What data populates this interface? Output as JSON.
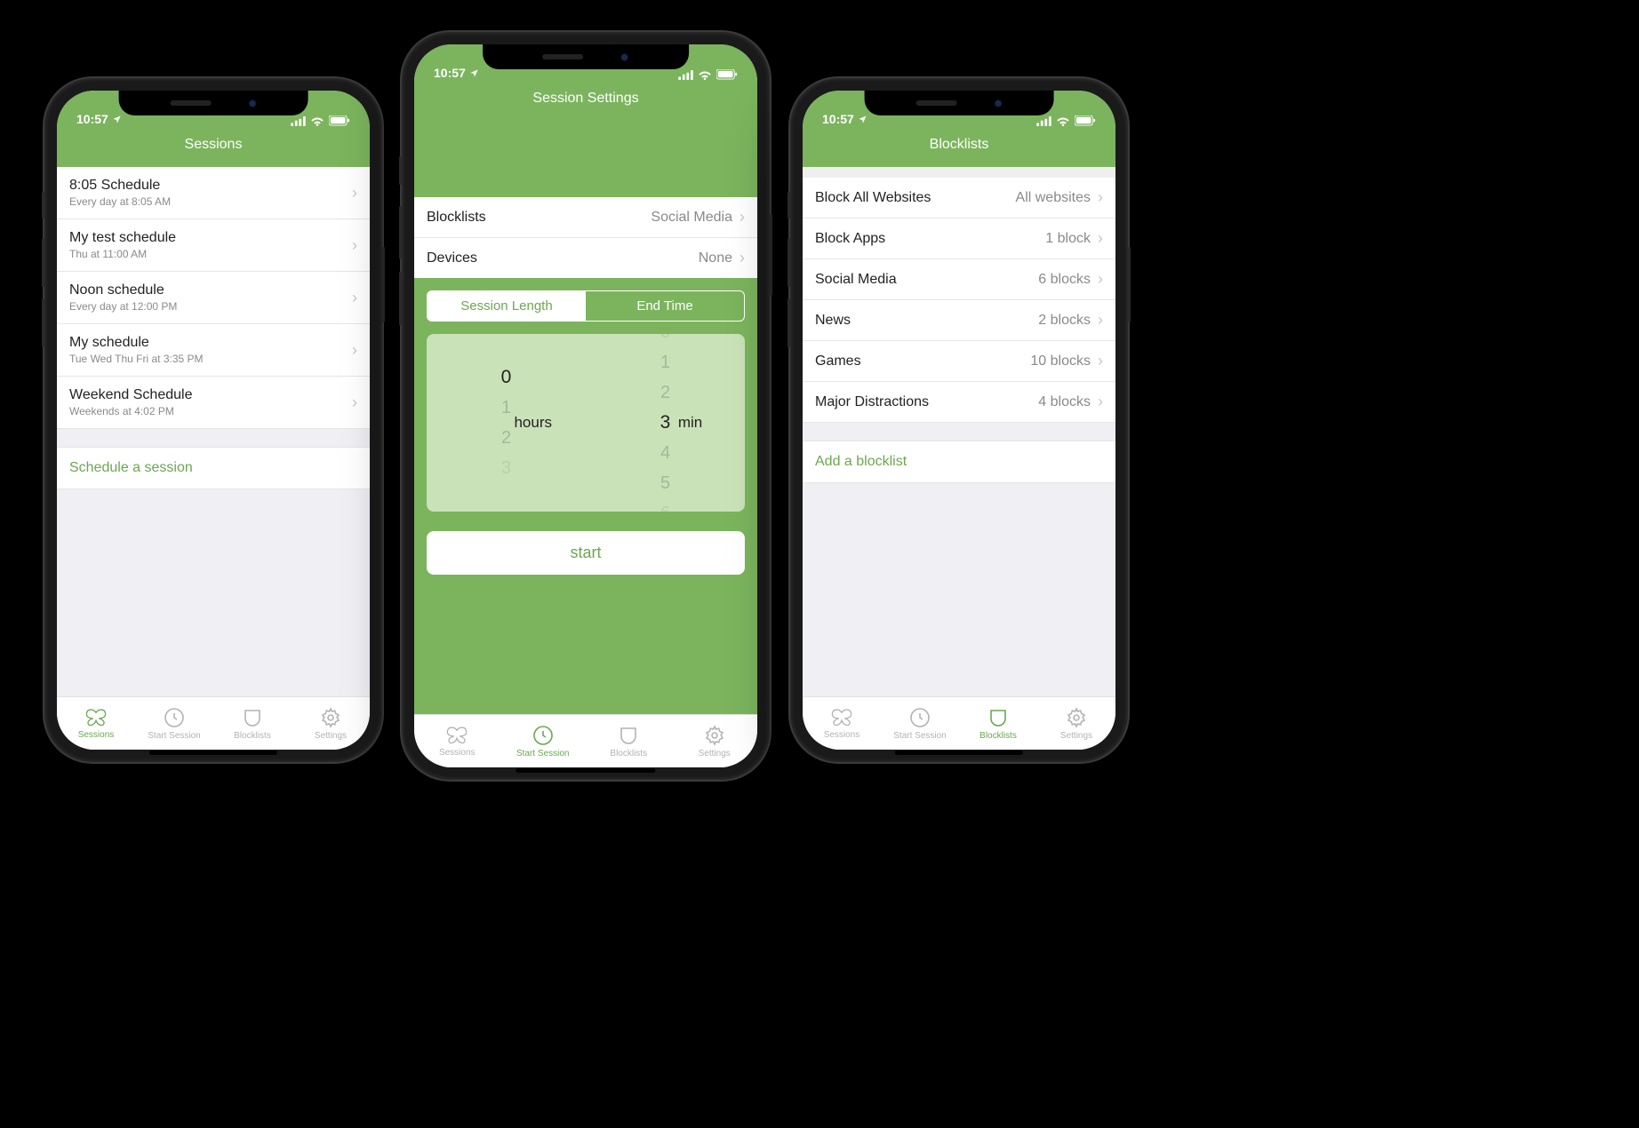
{
  "status_time": "10:57",
  "tabs": {
    "sessions": "Sessions",
    "start": "Start Session",
    "blocklists": "Blocklists",
    "settings": "Settings"
  },
  "phone1": {
    "header": "Sessions",
    "items": [
      {
        "title": "8:05 Schedule",
        "sub": "Every day at 8:05 AM"
      },
      {
        "title": "My test schedule",
        "sub": "Thu at 11:00 AM"
      },
      {
        "title": "Noon schedule",
        "sub": "Every day at 12:00 PM"
      },
      {
        "title": "My schedule",
        "sub": "Tue Wed Thu Fri at 3:35 PM"
      },
      {
        "title": "Weekend Schedule",
        "sub": "Weekends at 4:02 PM"
      }
    ],
    "action": "Schedule a session"
  },
  "phone2": {
    "header": "Session Settings",
    "rows": {
      "blocklists_label": "Blocklists",
      "blocklists_value": "Social Media",
      "devices_label": "Devices",
      "devices_value": "None"
    },
    "seg": {
      "length": "Session Length",
      "end": "End Time"
    },
    "picker": {
      "hours_value": "0",
      "hours_label": "hours",
      "min_value": "3",
      "min_label": "min",
      "opts_h": [
        " ",
        "0",
        "1",
        "2",
        "3"
      ],
      "opts_m": [
        "1",
        "2",
        "3",
        "4",
        "5"
      ]
    },
    "start": "start"
  },
  "phone3": {
    "header": "Blocklists",
    "items": [
      {
        "title": "Block All Websites",
        "value": "All websites"
      },
      {
        "title": "Block Apps",
        "value": "1 block"
      },
      {
        "title": "Social Media",
        "value": "6 blocks"
      },
      {
        "title": "News",
        "value": "2 blocks"
      },
      {
        "title": "Games",
        "value": "10 blocks"
      },
      {
        "title": "Major Distractions",
        "value": "4 blocks"
      }
    ],
    "action": "Add a blocklist"
  }
}
